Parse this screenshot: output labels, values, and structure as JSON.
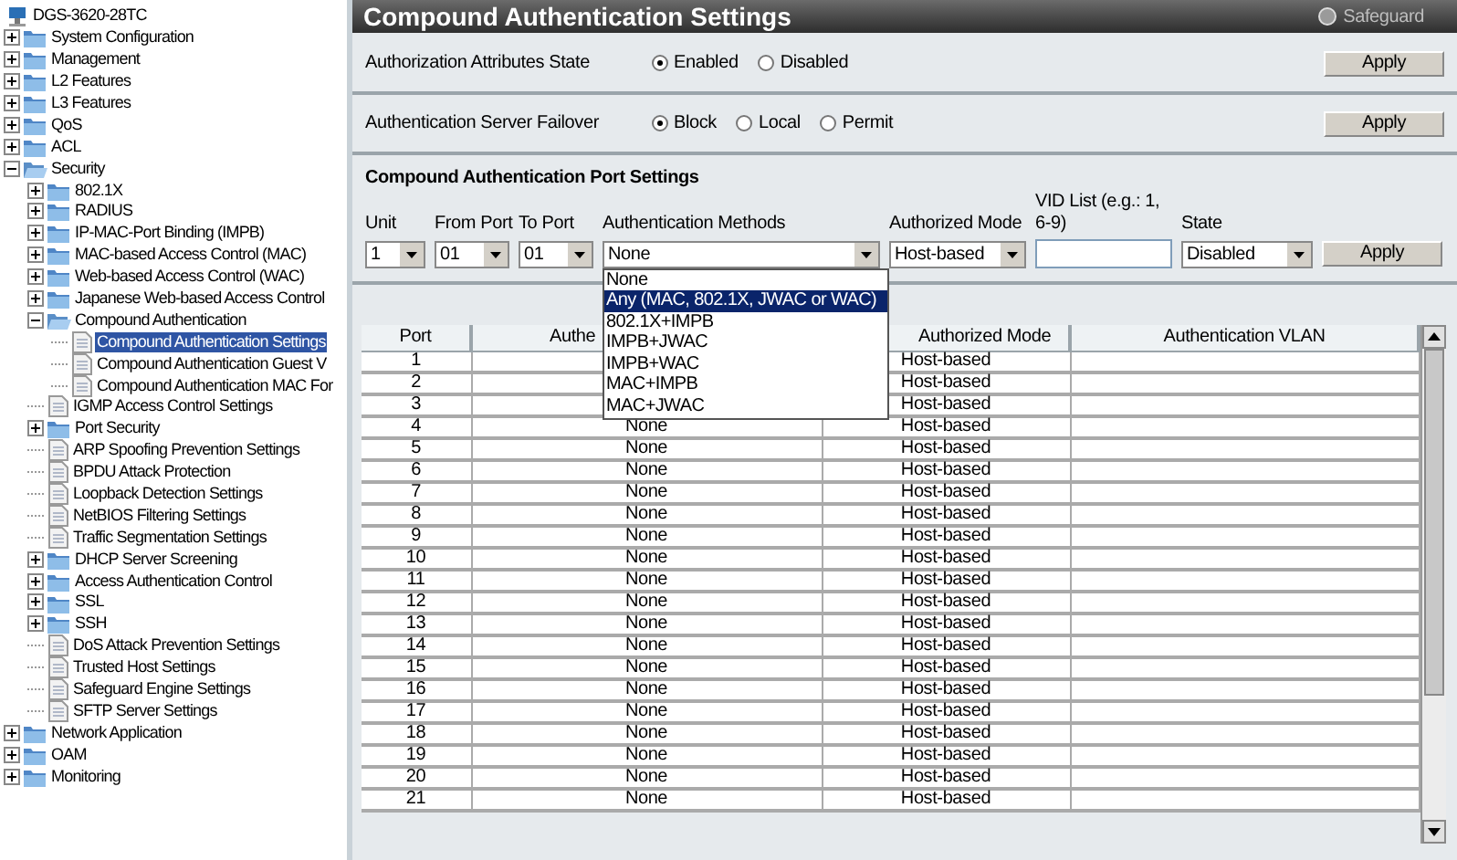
{
  "tree": {
    "label": "DGS-3620-28TC",
    "kind": "device",
    "selected": false,
    "children": [
      {
        "label": "System Configuration",
        "kind": "folder",
        "expanded": false,
        "selected": false
      },
      {
        "label": "Management",
        "kind": "folder",
        "expanded": false,
        "selected": false
      },
      {
        "label": "L2 Features",
        "kind": "folder",
        "expanded": false,
        "selected": false
      },
      {
        "label": "L3 Features",
        "kind": "folder",
        "expanded": false,
        "selected": false
      },
      {
        "label": "QoS",
        "kind": "folder",
        "expanded": false,
        "selected": false
      },
      {
        "label": "ACL",
        "kind": "folder",
        "expanded": false,
        "selected": false
      },
      {
        "label": "Security",
        "kind": "folder",
        "expanded": true,
        "selected": false,
        "children": [
          {
            "label": "802.1X",
            "kind": "folder",
            "expanded": false,
            "selected": false
          },
          {
            "label": "RADIUS",
            "kind": "folder",
            "expanded": false,
            "selected": false
          },
          {
            "label": "IP-MAC-Port Binding (IMPB)",
            "kind": "folder",
            "expanded": false,
            "selected": false
          },
          {
            "label": "MAC-based Access Control (MAC)",
            "kind": "folder",
            "expanded": false,
            "selected": false
          },
          {
            "label": "Web-based Access Control (WAC)",
            "kind": "folder",
            "expanded": false,
            "selected": false
          },
          {
            "label": "Japanese Web-based Access Control",
            "kind": "folder",
            "expanded": false,
            "selected": false
          },
          {
            "label": "Compound Authentication",
            "kind": "folder",
            "expanded": true,
            "selected": false,
            "children": [
              {
                "label": "Compound Authentication Settings",
                "kind": "page",
                "selected": true
              },
              {
                "label": "Compound Authentication Guest V",
                "kind": "page",
                "selected": false
              },
              {
                "label": "Compound Authentication MAC For",
                "kind": "page",
                "selected": false
              }
            ]
          },
          {
            "label": "IGMP Access Control Settings",
            "kind": "page",
            "selected": false
          },
          {
            "label": "Port Security",
            "kind": "folder",
            "expanded": false,
            "selected": false
          },
          {
            "label": "ARP Spoofing Prevention Settings",
            "kind": "page",
            "selected": false
          },
          {
            "label": "BPDU Attack Protection",
            "kind": "page",
            "selected": false
          },
          {
            "label": "Loopback Detection Settings",
            "kind": "page",
            "selected": false
          },
          {
            "label": "NetBIOS Filtering Settings",
            "kind": "page",
            "selected": false
          },
          {
            "label": "Traffic Segmentation Settings",
            "kind": "page",
            "selected": false
          },
          {
            "label": "DHCP Server Screening",
            "kind": "folder",
            "expanded": false,
            "selected": false
          },
          {
            "label": "Access Authentication Control",
            "kind": "folder",
            "expanded": false,
            "selected": false
          },
          {
            "label": "SSL",
            "kind": "folder",
            "expanded": false,
            "selected": false
          },
          {
            "label": "SSH",
            "kind": "folder",
            "expanded": false,
            "selected": false
          },
          {
            "label": "DoS Attack Prevention Settings",
            "kind": "page",
            "selected": false
          },
          {
            "label": "Trusted Host Settings",
            "kind": "page",
            "selected": false
          },
          {
            "label": "Safeguard Engine Settings",
            "kind": "page",
            "selected": false
          },
          {
            "label": "SFTP Server Settings",
            "kind": "page",
            "selected": false
          }
        ]
      },
      {
        "label": "Network Application",
        "kind": "folder",
        "expanded": false,
        "selected": false
      },
      {
        "label": "OAM",
        "kind": "folder",
        "expanded": false,
        "selected": false
      },
      {
        "label": "Monitoring",
        "kind": "folder",
        "expanded": false,
        "selected": false
      }
    ]
  },
  "header": {
    "title": "Compound Authentication Settings",
    "indicator": "Safeguard"
  },
  "settings": [
    {
      "label": "Authorization Attributes State",
      "options": [
        {
          "label": "Enabled",
          "selected": true
        },
        {
          "label": "Disabled",
          "selected": false
        }
      ],
      "button": "Apply"
    },
    {
      "label": "Authentication Server Failover",
      "options": [
        {
          "label": "Block",
          "selected": true
        },
        {
          "label": "Local",
          "selected": false
        },
        {
          "label": "Permit",
          "selected": false
        }
      ],
      "button": "Apply"
    }
  ],
  "port_settings": {
    "heading": "Compound Authentication Port Settings",
    "fields": [
      {
        "label": "Unit",
        "kind": "select",
        "value": "1"
      },
      {
        "label": "From Port",
        "kind": "select",
        "value": "01"
      },
      {
        "label": "To Port",
        "kind": "select",
        "value": "01"
      },
      {
        "label": "Authentication Methods",
        "kind": "select",
        "value": "None",
        "expanded": true
      },
      {
        "label": "Authorized Mode",
        "kind": "select",
        "value": "Host-based"
      },
      {
        "label": "VID List (e.g.: 1, 6-9)",
        "kind": "input"
      },
      {
        "label": "State",
        "kind": "select",
        "value": "Disabled"
      }
    ],
    "button": "Apply",
    "dropdown": [
      {
        "label": "None",
        "selected": false
      },
      {
        "label": "Any (MAC, 802.1X, JWAC or WAC)",
        "selected": true
      },
      {
        "label": "802.1X+IMPB",
        "selected": false
      },
      {
        "label": "IMPB+JWAC",
        "selected": false
      },
      {
        "label": "IMPB+WAC",
        "selected": false
      },
      {
        "label": "MAC+IMPB",
        "selected": false
      },
      {
        "label": "MAC+JWAC",
        "selected": false
      }
    ]
  },
  "table": {
    "columns": [
      "Port",
      "Authe",
      "Authorized Mode",
      "Authentication VLAN"
    ],
    "rows": [
      {
        "port": "1",
        "mode": "Host-based"
      },
      {
        "port": "2",
        "mode": "Host-based"
      },
      {
        "port": "3",
        "mode": "Host-based"
      },
      {
        "port": "4",
        "method": "None",
        "mode": "Host-based"
      },
      {
        "port": "5",
        "method": "None",
        "mode": "Host-based"
      },
      {
        "port": "6",
        "method": "None",
        "mode": "Host-based"
      },
      {
        "port": "7",
        "method": "None",
        "mode": "Host-based"
      },
      {
        "port": "8",
        "method": "None",
        "mode": "Host-based"
      },
      {
        "port": "9",
        "method": "None",
        "mode": "Host-based"
      },
      {
        "port": "10",
        "method": "None",
        "mode": "Host-based"
      },
      {
        "port": "11",
        "method": "None",
        "mode": "Host-based"
      },
      {
        "port": "12",
        "method": "None",
        "mode": "Host-based"
      },
      {
        "port": "13",
        "method": "None",
        "mode": "Host-based"
      },
      {
        "port": "14",
        "method": "None",
        "mode": "Host-based"
      },
      {
        "port": "15",
        "method": "None",
        "mode": "Host-based"
      },
      {
        "port": "16",
        "method": "None",
        "mode": "Host-based"
      },
      {
        "port": "17",
        "method": "None",
        "mode": "Host-based"
      },
      {
        "port": "18",
        "method": "None",
        "mode": "Host-based"
      },
      {
        "port": "19",
        "method": "None",
        "mode": "Host-based"
      },
      {
        "port": "20",
        "method": "None",
        "mode": "Host-based"
      },
      {
        "port": "21",
        "method": "None",
        "mode": "Host-based"
      }
    ]
  }
}
